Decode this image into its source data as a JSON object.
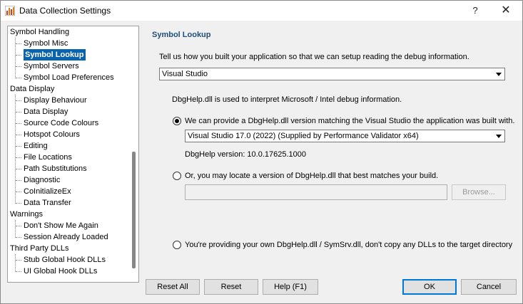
{
  "window": {
    "title": "Data Collection Settings",
    "help_glyph": "?",
    "close_glyph": "✕"
  },
  "tree": {
    "items": [
      {
        "label": "Symbol Handling",
        "level": 0
      },
      {
        "label": "Symbol Misc",
        "level": 1
      },
      {
        "label": "Symbol Lookup",
        "level": 1,
        "selected": true
      },
      {
        "label": "Symbol Servers",
        "level": 1
      },
      {
        "label": "Symbol Load Preferences",
        "level": 1
      },
      {
        "label": "Data Display",
        "level": 0
      },
      {
        "label": "Display Behaviour",
        "level": 1
      },
      {
        "label": "Data Display",
        "level": 1
      },
      {
        "label": "Source Code Colours",
        "level": 1
      },
      {
        "label": "Hotspot Colours",
        "level": 1
      },
      {
        "label": "Editing",
        "level": 1
      },
      {
        "label": "File Locations",
        "level": 1
      },
      {
        "label": "Path Substitutions",
        "level": 1
      },
      {
        "label": "Diagnostic",
        "level": 1
      },
      {
        "label": "CoInitializeEx",
        "level": 1
      },
      {
        "label": "Data Transfer",
        "level": 1
      },
      {
        "label": "Warnings",
        "level": 0
      },
      {
        "label": "Don't Show Me Again",
        "level": 1
      },
      {
        "label": "Session Already Loaded",
        "level": 1
      },
      {
        "label": "Third Party DLLs",
        "level": 0
      },
      {
        "label": "Stub Global Hook DLLs",
        "level": 1
      },
      {
        "label": "UI Global Hook DLLs",
        "level": 1
      }
    ]
  },
  "panel": {
    "title": "Symbol Lookup",
    "intro": "Tell us how you built your application so that we can setup reading the debug information.",
    "build_tool_selected": "Visual Studio",
    "dbghelp_desc": "DbgHelp.dll is used to interpret Microsoft / Intel debug information.",
    "option1_label": "We can provide a DbgHelp.dll version matching the Visual Studio the application was built with.",
    "vs_version_selected": "Visual Studio 17.0 (2022) (Supplied by  Performance Validator x64)",
    "dbghelp_version": "DbgHelp version: 10.0.17625.1000",
    "option2_label": "Or, you may locate a version of DbgHelp.dll that best matches your build.",
    "locate_path_value": "",
    "browse_label": "Browse...",
    "option3_label": "You're providing your own DbgHelp.dll / SymSrv.dll, don't copy any DLLs to the target directory",
    "selected_option": 1
  },
  "buttons": {
    "reset_all": "Reset All",
    "reset": "Reset",
    "help": "Help (F1)",
    "ok": "OK",
    "cancel": "Cancel"
  }
}
